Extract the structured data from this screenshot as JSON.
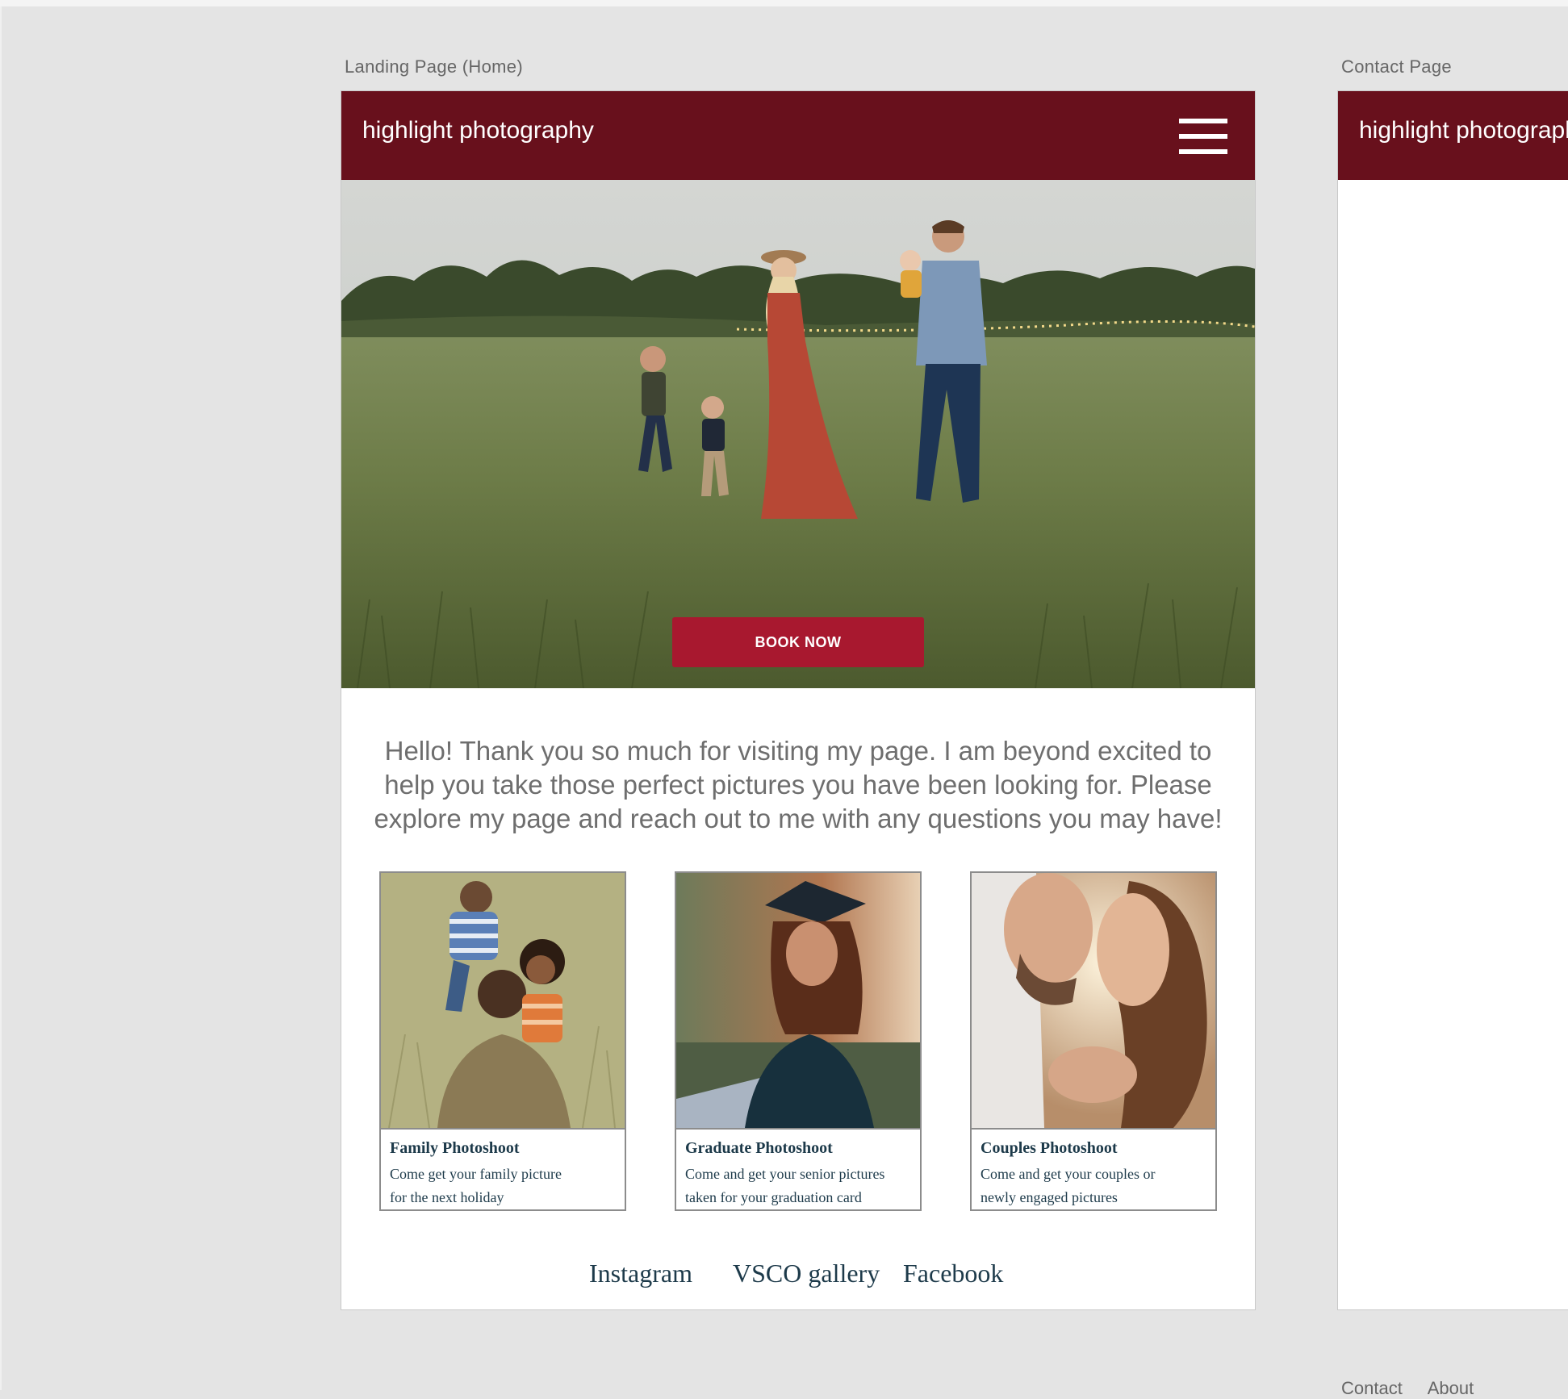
{
  "artboards": {
    "landing_label": "Landing Page (Home)",
    "contact_label": "Contact Page"
  },
  "landing": {
    "brand": "highlight photography",
    "menu_icon": "hamburger-menu-icon",
    "book_button": "BOOK NOW",
    "intro": "Hello! Thank you so much for visiting my page.  I am beyond excited to help you take those perfect pictures you have been looking for.  Please explore my page and reach out to me with any questions you may have!",
    "cards": [
      {
        "title": "Family Photoshoot",
        "line1": "Come get your family picture",
        "line2": "for the next holiday"
      },
      {
        "title": "Graduate Photoshoot",
        "line1": "Come and get your senior pictures",
        "line2": "taken for your graduation card"
      },
      {
        "title": "Couples Photoshoot",
        "line1": "Come and get your couples or",
        "line2": "newly engaged pictures"
      }
    ],
    "social": [
      "Instagram",
      "VSCO gallery",
      "Facebook"
    ]
  },
  "contact": {
    "brand": "highlight photography",
    "footer_links": [
      "Contact",
      "About"
    ]
  },
  "colors": {
    "nav": "#68101c",
    "button": "#a8182f",
    "serif_text": "#1d3a4a",
    "intro_text": "#6e6e6e",
    "canvas": "#e4e4e4"
  }
}
